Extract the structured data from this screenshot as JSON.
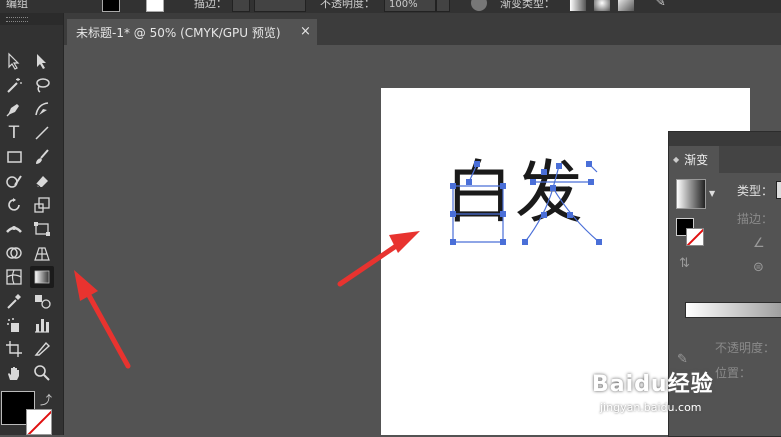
{
  "control_bar": {
    "left_text": "编组",
    "stroke_label": "描边：",
    "opacity_label": "不透明度：",
    "opacity_value": "100%",
    "gradient_type_label": "渐变类型："
  },
  "document": {
    "tab_title": "未标题-1* @ 50% (CMYK/GPU 预览)",
    "close_glyph": "×"
  },
  "artboard": {
    "text": "白发"
  },
  "gradient_panel": {
    "tab_label": "渐变",
    "type_label": "类型：",
    "stroke_label": "描边：",
    "opacity_label": "不透明度：",
    "location_label": "位置："
  },
  "watermark": {
    "brand": "Baidu经验",
    "url": "jingyan.baidu.com"
  },
  "toolbar": {
    "type_tool_glyph": "T",
    "swap_glyph": "⤴"
  },
  "colors": {
    "annotation_red": "#e8332f",
    "selection_blue": "#4a6fd8",
    "workspace_gray": "#535353"
  },
  "icons": [
    "selection-icon",
    "direct-selection-icon",
    "magic-wand-icon",
    "lasso-icon",
    "pen-icon",
    "curvature-icon",
    "type-icon",
    "line-segment-icon",
    "rectangle-icon",
    "paintbrush-icon",
    "shaper-icon",
    "eraser-icon",
    "rotate-icon",
    "scale-icon",
    "width-icon",
    "free-transform-icon",
    "shape-builder-icon",
    "perspective-grid-icon",
    "mesh-icon",
    "gradient-icon",
    "eyedropper-icon",
    "blend-icon",
    "symbol-sprayer-icon",
    "column-graph-icon",
    "artboard-icon",
    "slice-icon",
    "hand-icon",
    "zoom-icon"
  ]
}
